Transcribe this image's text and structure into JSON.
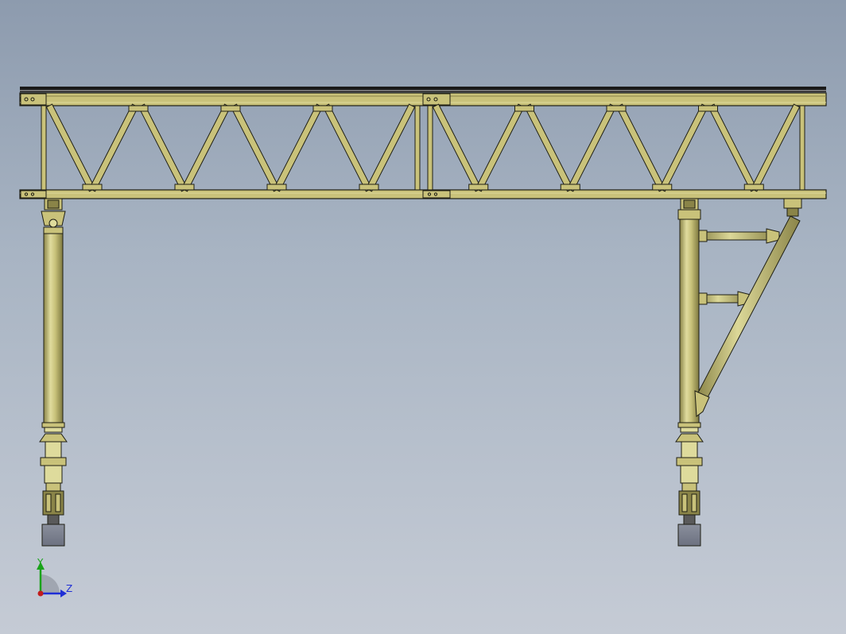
{
  "view": {
    "colors": {
      "steel": "#c9c27a",
      "steel_dark": "#8a8448",
      "steel_light": "#dedb9c",
      "outline": "#1e1e14",
      "rail": "#1a1a1a",
      "pad": "#7a7f8c"
    }
  },
  "triad": {
    "y_label": "Y",
    "z_label": "Z",
    "colors": {
      "y": "#1aa31a",
      "z": "#1f2fd6",
      "origin": "#c21c1c",
      "arc": "#9aa0aa"
    }
  }
}
